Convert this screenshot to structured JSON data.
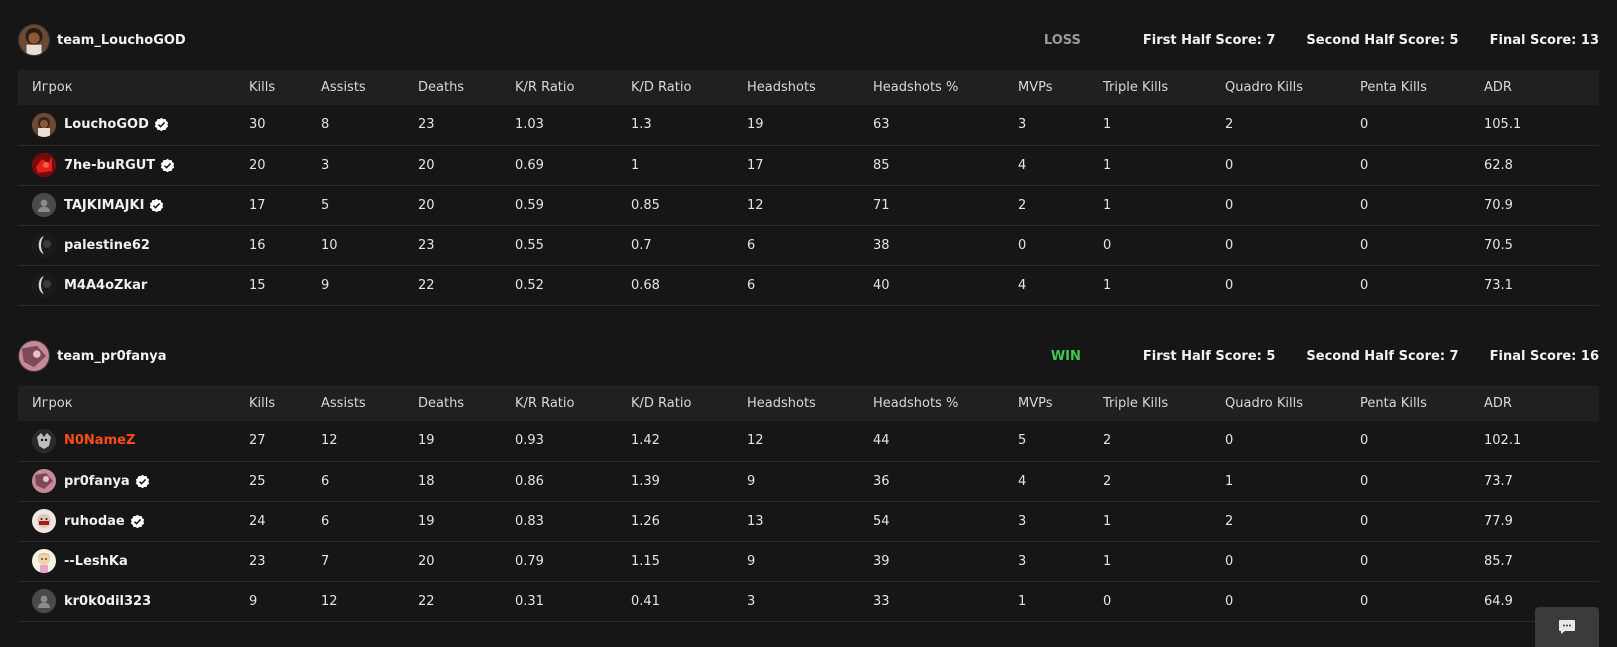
{
  "columns": [
    "Игрок",
    "Kills",
    "Assists",
    "Deaths",
    "K/R Ratio",
    "K/D Ratio",
    "Headshots",
    "Headshots %",
    "MVPs",
    "Triple Kills",
    "Quadro Kills",
    "Penta Kills",
    "ADR"
  ],
  "teams": [
    {
      "name": "team_LouchoGOD",
      "result": "LOSS",
      "result_color": "#9a9a9a",
      "first_half": "First Half Score: 7",
      "second_half": "Second Half Score: 5",
      "final": "Final Score: 13",
      "players": [
        {
          "name": "LouchoGOD",
          "verified": true,
          "avatar": "photo-avatar",
          "stats": [
            "30",
            "8",
            "23",
            "1.03",
            "1.3",
            "19",
            "63",
            "3",
            "1",
            "2",
            "0",
            "105.1"
          ]
        },
        {
          "name": "7he-buRGUT",
          "verified": true,
          "avatar": "red-avatar",
          "stats": [
            "20",
            "3",
            "20",
            "0.69",
            "1",
            "17",
            "85",
            "4",
            "1",
            "0",
            "0",
            "62.8"
          ]
        },
        {
          "name": "TAJKIMAJKI",
          "verified": true,
          "avatar": "default-avatar",
          "stats": [
            "17",
            "5",
            "20",
            "0.59",
            "0.85",
            "12",
            "71",
            "2",
            "1",
            "0",
            "0",
            "70.9"
          ]
        },
        {
          "name": "palestine62",
          "verified": false,
          "avatar": "dark-avatar",
          "stats": [
            "16",
            "10",
            "23",
            "0.55",
            "0.7",
            "6",
            "38",
            "0",
            "0",
            "0",
            "0",
            "70.5"
          ]
        },
        {
          "name": "M4A4oZkar",
          "verified": false,
          "avatar": "dark-avatar",
          "stats": [
            "15",
            "9",
            "22",
            "0.52",
            "0.68",
            "6",
            "40",
            "4",
            "1",
            "0",
            "0",
            "73.1"
          ]
        }
      ]
    },
    {
      "name": "team_pr0fanya",
      "result": "WIN",
      "result_color": "#3ec94e",
      "first_half": "First Half Score: 5",
      "second_half": "Second Half Score: 7",
      "final": "Final Score: 16",
      "players": [
        {
          "name": "N0NameZ",
          "verified": false,
          "highlight": true,
          "avatar": "wolf-avatar",
          "stats": [
            "27",
            "12",
            "19",
            "0.93",
            "1.42",
            "12",
            "44",
            "5",
            "2",
            "0",
            "0",
            "102.1"
          ]
        },
        {
          "name": "pr0fanya",
          "verified": true,
          "avatar": "pink-avatar",
          "stats": [
            "25",
            "6",
            "18",
            "0.86",
            "1.39",
            "9",
            "36",
            "4",
            "2",
            "1",
            "0",
            "73.7"
          ]
        },
        {
          "name": "ruhodae",
          "verified": true,
          "avatar": "face-avatar",
          "stats": [
            "24",
            "6",
            "19",
            "0.83",
            "1.26",
            "13",
            "54",
            "3",
            "1",
            "2",
            "0",
            "77.9"
          ]
        },
        {
          "name": "--LeshKa",
          "verified": false,
          "avatar": "cartoon-avatar",
          "stats": [
            "23",
            "7",
            "20",
            "0.79",
            "1.15",
            "9",
            "39",
            "3",
            "1",
            "0",
            "0",
            "85.7"
          ]
        },
        {
          "name": "kr0k0dil323",
          "verified": false,
          "avatar": "default-avatar",
          "stats": [
            "9",
            "12",
            "22",
            "0.31",
            "0.41",
            "3",
            "33",
            "1",
            "0",
            "0",
            "0",
            "64.9"
          ]
        }
      ]
    }
  ],
  "chat_icon": "chat-icon"
}
